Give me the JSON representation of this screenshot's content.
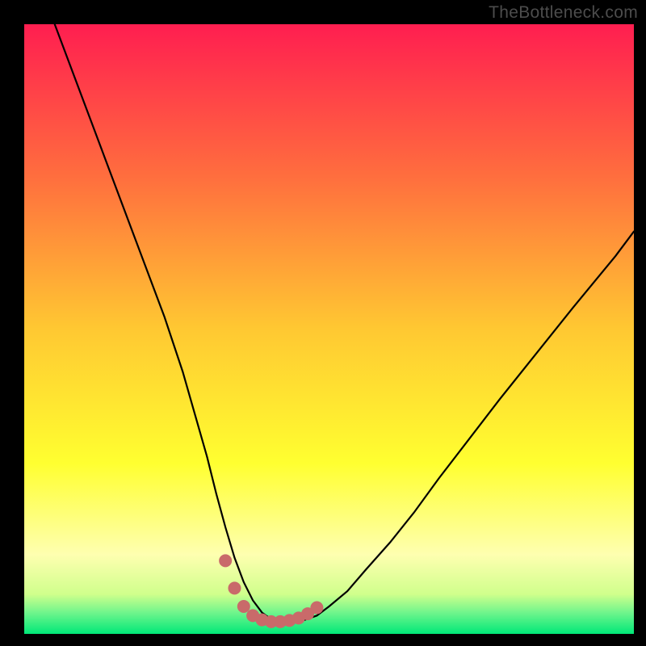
{
  "watermark": "TheBottleneck.com",
  "colors": {
    "frame": "#000000",
    "watermark_text": "#4c4c4c",
    "curve": "#000000",
    "markers": "#c96a6a",
    "gradient_stops": [
      {
        "offset": 0,
        "color": "#ff1e50"
      },
      {
        "offset": 0.25,
        "color": "#ff6e3e"
      },
      {
        "offset": 0.5,
        "color": "#ffc832"
      },
      {
        "offset": 0.72,
        "color": "#ffff30"
      },
      {
        "offset": 0.87,
        "color": "#feffb0"
      },
      {
        "offset": 0.935,
        "color": "#d0ff8c"
      },
      {
        "offset": 0.965,
        "color": "#70f58c"
      },
      {
        "offset": 1.0,
        "color": "#00e878"
      }
    ]
  },
  "chart_data": {
    "type": "line",
    "title": "",
    "xlabel": "",
    "ylabel": "",
    "xlim": [
      0,
      100
    ],
    "ylim": [
      0,
      100
    ],
    "series": [
      {
        "name": "bottleneck-curve",
        "x": [
          5,
          8,
          11,
          14,
          17,
          20,
          23,
          26,
          28,
          30,
          31.5,
          33,
          34.5,
          36,
          37.5,
          39,
          40.5,
          42,
          44,
          46,
          48,
          50,
          53,
          56,
          60,
          64,
          68,
          73,
          78,
          84,
          90,
          97,
          100
        ],
        "values": [
          100,
          92,
          84,
          76,
          68,
          60,
          52,
          43,
          36,
          29,
          23,
          17.5,
          12.5,
          8.5,
          5.5,
          3.5,
          2.4,
          2,
          2,
          2.3,
          3,
          4.5,
          7,
          10.5,
          15,
          20,
          25.5,
          32,
          38.5,
          46,
          53.5,
          62,
          66
        ]
      }
    ],
    "markers": {
      "name": "flat-bottom-markers",
      "x": [
        33,
        34.5,
        36,
        37.5,
        39,
        40.5,
        42,
        43.5,
        45,
        46.5,
        48
      ],
      "values": [
        12,
        7.5,
        4.5,
        3,
        2.3,
        2,
        2,
        2.2,
        2.6,
        3.3,
        4.3
      ],
      "radius_px": 8
    }
  }
}
